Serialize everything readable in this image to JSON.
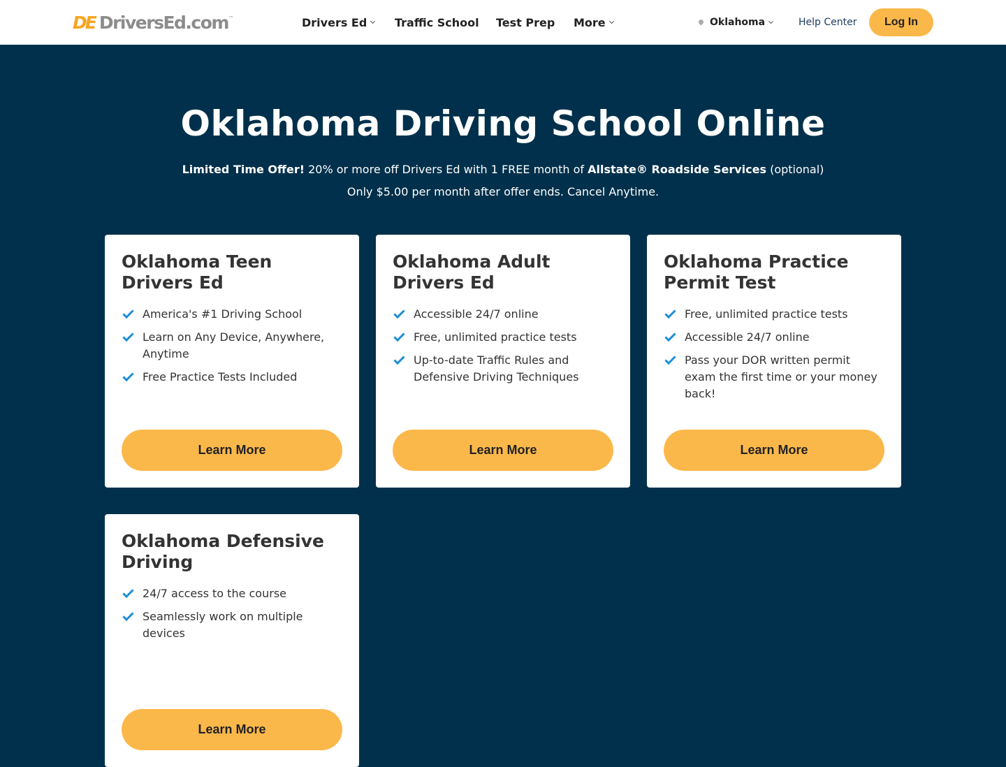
{
  "header": {
    "logo_mark": "DE",
    "logo_text": "DriversEd.com",
    "logo_tm": "™",
    "nav": [
      {
        "label": "Drivers Ed"
      },
      {
        "label": "Traffic School"
      },
      {
        "label": "Test Prep"
      },
      {
        "label": "More"
      }
    ],
    "location": "Oklahoma",
    "help": "Help Center",
    "login": "Log In"
  },
  "hero": {
    "title": "Oklahoma Driving School Online",
    "offer_bold": "Limited Time Offer!",
    "offer_text": " 20% or more off Drivers Ed with 1 FREE month of ",
    "offer_brand": "Allstate® Roadside Services",
    "offer_optional": " (optional)",
    "line2": "Only $5.00 per month after offer ends. Cancel Anytime."
  },
  "cards": [
    {
      "title": "Oklahoma Teen Drivers Ed",
      "features": [
        "America's #1 Driving School",
        "Learn on Any Device, Anywhere, Anytime",
        "Free Practice Tests Included"
      ],
      "button": "Learn More"
    },
    {
      "title": "Oklahoma Adult Drivers Ed",
      "features": [
        "Accessible 24/7 online",
        "Free, unlimited practice tests",
        "Up-to-date Traffic Rules and Defensive Driving Techniques"
      ],
      "button": "Learn More"
    },
    {
      "title": "Oklahoma Practice Permit Test",
      "features": [
        "Free, unlimited practice tests",
        "Accessible 24/7 online",
        "Pass your DOR written permit exam the first time or your money back!"
      ],
      "button": "Learn More"
    },
    {
      "title": "Oklahoma Defensive Driving",
      "features": [
        "24/7 access to the course",
        "Seamlessly work on multiple devices"
      ],
      "button": "Learn More"
    }
  ],
  "colors": {
    "hero_bg": "#00304b",
    "accent": "#fbb84a",
    "check": "#1d8fd8"
  }
}
